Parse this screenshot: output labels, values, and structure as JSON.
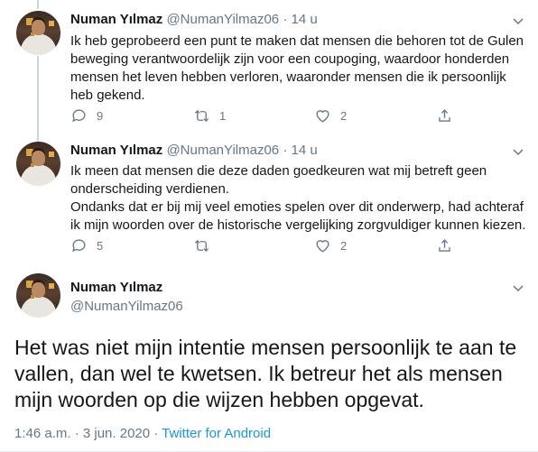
{
  "tweets": [
    {
      "name": "Numan Yılmaz",
      "handle": "@NumanYilmaz06",
      "sep": "·",
      "time": "14 u",
      "text": "Ik heb geprobeerd een punt te maken dat mensen die behoren tot de Gulen beweging verantwoordelijk zijn voor een coupoging, waardoor honderden mensen het leven hebben verloren, waaronder mensen die ik persoonlijk heb gekend.",
      "replies": "9",
      "retweets": "1",
      "likes": "2"
    },
    {
      "name": "Numan Yılmaz",
      "handle": "@NumanYilmaz06",
      "sep": "·",
      "time": "14 u",
      "text": "Ik meen dat mensen die deze daden goedkeuren wat mij betreft geen onderscheiding verdienen.\nOndanks dat er bij mij veel emoties spelen over dit onderwerp, had achteraf ik mijn woorden over de historische vergelijking zorgvuldiger kunnen kiezen.",
      "replies": "5",
      "retweets": "",
      "likes": "2"
    }
  ],
  "main": {
    "name": "Numan Yılmaz",
    "handle": "@NumanYilmaz06",
    "text": "Het was niet mijn intentie mensen persoonlijk te aan te vallen, dan wel te kwetsen. Ik betreur het als mensen mijn woorden op die wijzen hebben opgevat.",
    "timestamp": "1:46 a.m. · 3 jun. 2020 · ",
    "source": "Twitter for Android"
  },
  "colors": {
    "text": "#14171a",
    "secondary": "#657786",
    "link": "#1b95e0",
    "thread_line": "#ccd6dd"
  }
}
